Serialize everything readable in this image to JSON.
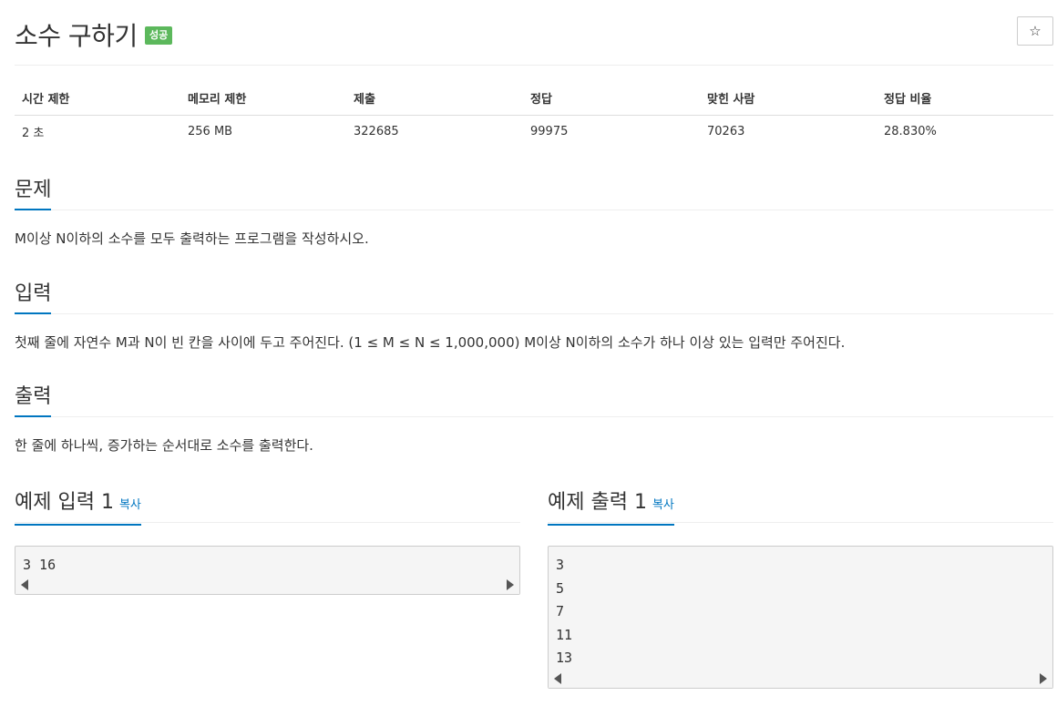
{
  "problem": {
    "title": "소수 구하기",
    "badge": "성공",
    "star": "☆"
  },
  "info": {
    "headers": [
      "시간 제한",
      "메모리 제한",
      "제출",
      "정답",
      "맞힌 사람",
      "정답 비율"
    ],
    "values": [
      "2 초",
      "256 MB",
      "322685",
      "99975",
      "70263",
      "28.830%"
    ]
  },
  "sections": {
    "problem": {
      "heading": "문제",
      "text": "M이상 N이하의 소수를 모두 출력하는 프로그램을 작성하시오."
    },
    "input": {
      "heading": "입력",
      "text": "첫째 줄에 자연수 M과 N이 빈 칸을 사이에 두고 주어진다. (1 ≤ M ≤ N ≤ 1,000,000) M이상 N이하의 소수가 하나 이상 있는 입력만 주어진다."
    },
    "output": {
      "heading": "출력",
      "text": "한 줄에 하나씩, 증가하는 순서대로 소수를 출력한다."
    }
  },
  "samples": {
    "input": {
      "heading": "예제 입력 1",
      "copy": "복사",
      "content": "3 16"
    },
    "output": {
      "heading": "예제 출력 1",
      "copy": "복사",
      "content": "3\n5\n7\n11\n13"
    }
  },
  "colors": {
    "accent": "#0076c0",
    "success": "#5cb85c"
  }
}
